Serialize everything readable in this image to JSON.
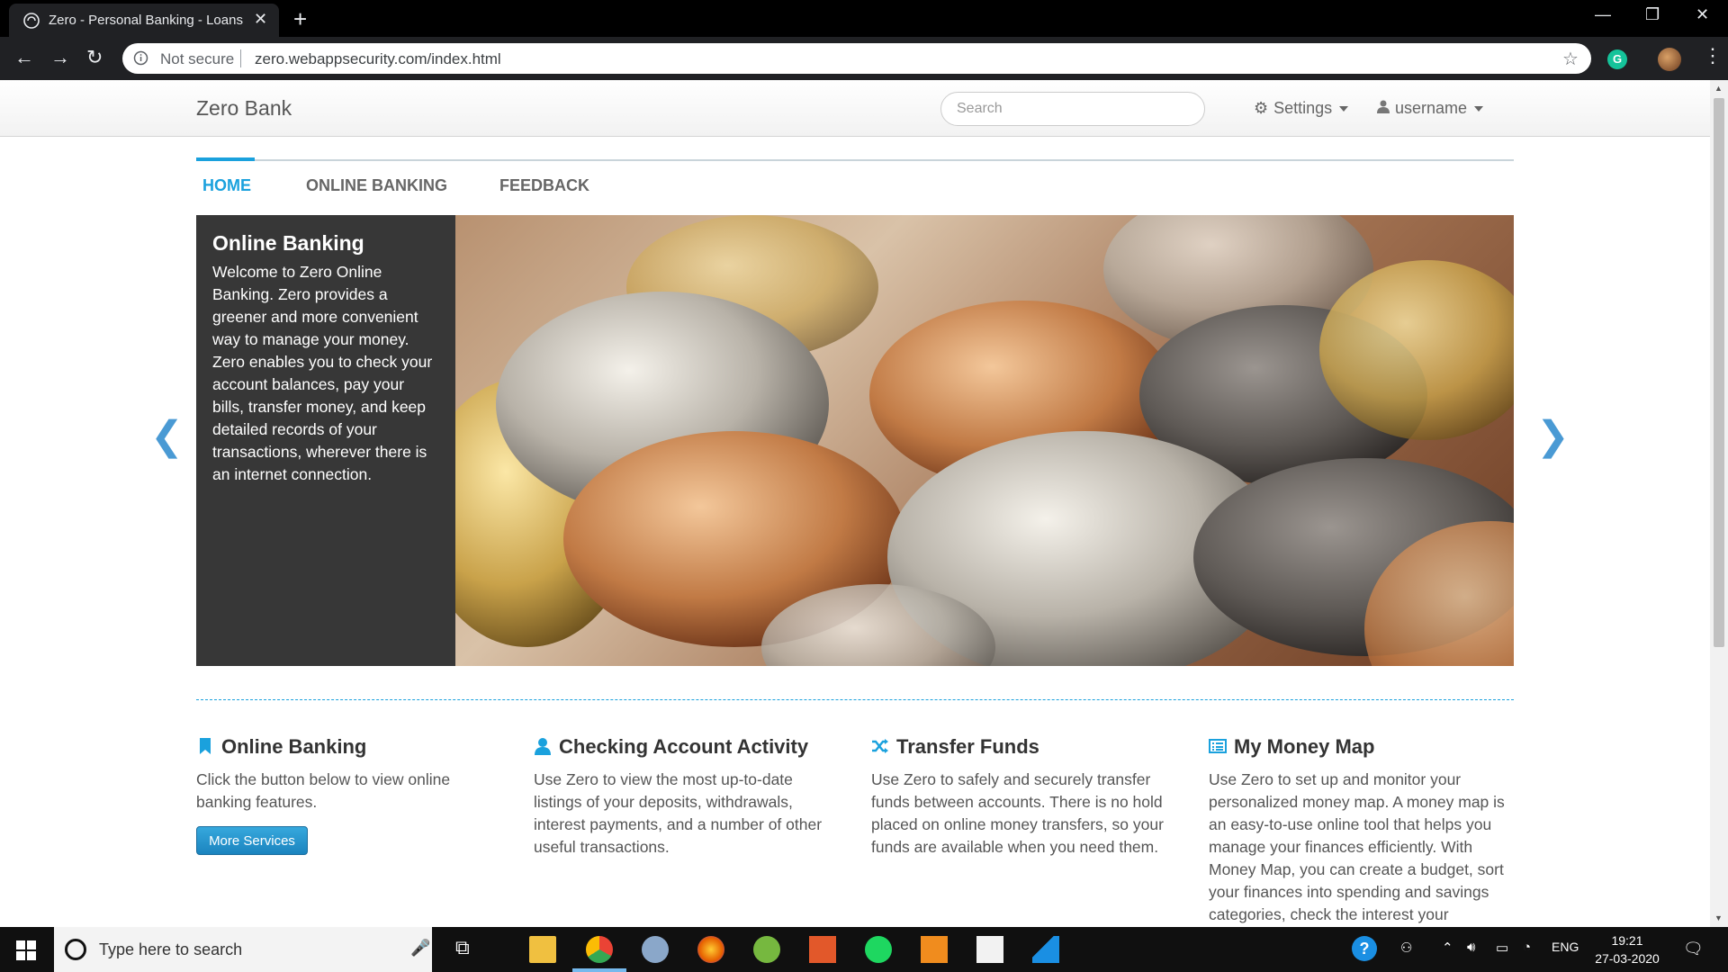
{
  "browser": {
    "tab_title": "Zero - Personal Banking - Loans",
    "security_label": "Not secure",
    "url": "zero.webappsecurity.com/index.html"
  },
  "navbar": {
    "brand": "Zero Bank",
    "search_placeholder": "Search",
    "settings_label": "Settings",
    "user_label": "username"
  },
  "tabs": [
    {
      "label": "HOME",
      "active": true
    },
    {
      "label": "ONLINE BANKING",
      "active": false
    },
    {
      "label": "FEEDBACK",
      "active": false
    }
  ],
  "carousel": {
    "title": "Online Banking",
    "text": "Welcome to Zero Online Banking. Zero provides a greener and more convenient way to manage your money. Zero enables you to check your account balances, pay your bills, transfer money, and keep detailed records of your transactions, wherever there is an internet connection.",
    "prev_glyph": "❮",
    "next_glyph": "❯",
    "image_icon": "coins-photo"
  },
  "features": [
    {
      "title": "Online Banking",
      "icon": "bookmark-icon",
      "text": "Click the button below to view online banking features.",
      "button": "More Services"
    },
    {
      "title": "Checking Account Activity",
      "icon": "user-icon",
      "text": "Use Zero to view the most up-to-date listings of your deposits, withdrawals, interest payments, and a number of other useful transactions."
    },
    {
      "title": "Transfer Funds",
      "icon": "shuffle-icon",
      "text": "Use Zero to safely and securely transfer funds between accounts. There is no hold placed on online money transfers, so your funds are available when you need them."
    },
    {
      "title": "My Money Map",
      "icon": "list-alt-icon",
      "text": "Use Zero to set up and monitor your personalized money map. A money map is an easy-to-use online tool that helps you manage your finances efficiently. With Money Map, you can create a budget, sort your finances into spending and savings categories, check the interest your"
    }
  ],
  "taskbar": {
    "search_placeholder": "Type here to search",
    "language": "ENG",
    "time": "19:21",
    "date": "27-03-2020"
  },
  "colors": {
    "accent": "#1aa1dd",
    "caption_bg": "#373737",
    "chrome_bg": "#202124"
  }
}
